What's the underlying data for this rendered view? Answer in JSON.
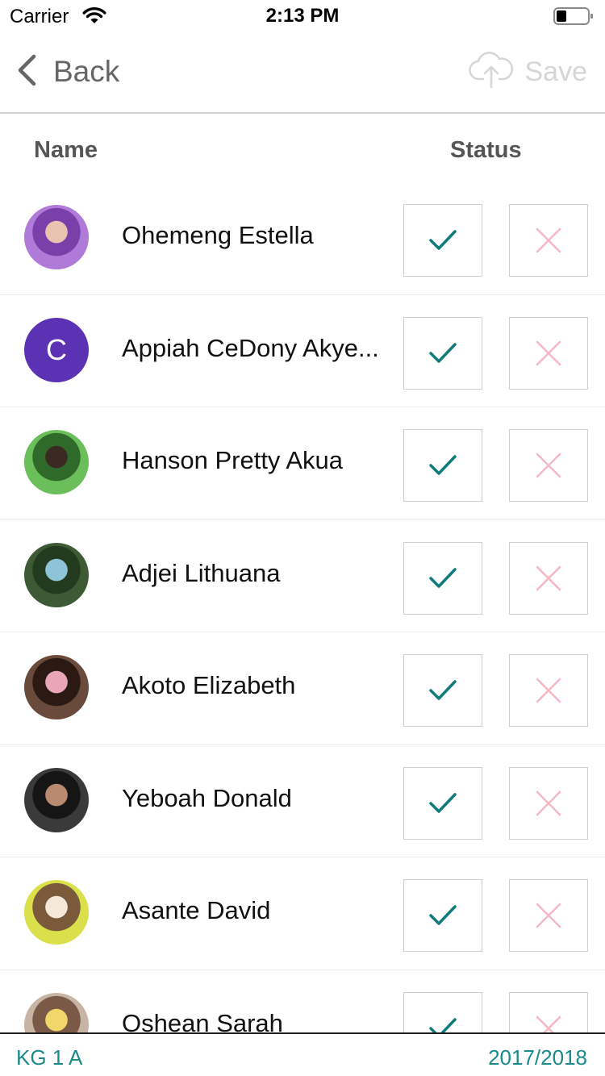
{
  "status_bar": {
    "carrier": "Carrier",
    "time": "2:13 PM"
  },
  "nav": {
    "back_label": "Back",
    "save_label": "Save"
  },
  "header": {
    "name_label": "Name",
    "status_label": "Status"
  },
  "students": [
    {
      "name": "Ohemeng Estella",
      "avatar_colors": [
        "#b07ad8",
        "#7a3fa8",
        "#e8c4b0"
      ]
    },
    {
      "name": "Appiah CeDony Akye...",
      "avatar_letter": "C"
    },
    {
      "name": "Hanson Pretty Akua",
      "avatar_colors": [
        "#6abf5a",
        "#2f6a2a",
        "#3a2a22"
      ]
    },
    {
      "name": "Adjei Lithuana",
      "avatar_colors": [
        "#3c5a34",
        "#233a1e",
        "#8fc4d8"
      ]
    },
    {
      "name": "Akoto Elizabeth",
      "avatar_colors": [
        "#6a4a3a",
        "#2b1a14",
        "#e9a6b8"
      ]
    },
    {
      "name": "Yeboah Donald",
      "avatar_colors": [
        "#3a3a3a",
        "#151515",
        "#b88a70"
      ]
    },
    {
      "name": "Asante David",
      "avatar_colors": [
        "#d9e04a",
        "#7a5a3a",
        "#f4e8d8"
      ]
    },
    {
      "name": "Oshean Sarah",
      "avatar_colors": [
        "#c8b4a4",
        "#7a5a46",
        "#f2d66a"
      ]
    }
  ],
  "footer": {
    "class_name": "KG 1 A",
    "year": "2017/2018"
  },
  "colors": {
    "accent": "#1a8a8a",
    "check": "#117a7a",
    "cross": "#f4b8c4",
    "avatar_letter_bg": "#5b32b4"
  }
}
